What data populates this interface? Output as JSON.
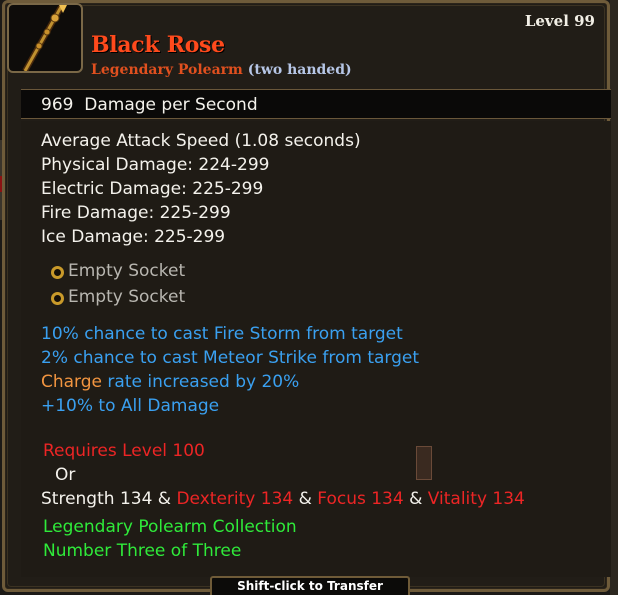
{
  "item": {
    "level_label": "Level 99",
    "name": "Black Rose",
    "type": "Legendary Polearm",
    "handedness": "(two handed)",
    "dps_value": "969",
    "dps_label": "Damage per Second",
    "icon": "polearm-icon"
  },
  "stats": {
    "attack_speed": "Average Attack Speed (1.08 seconds)",
    "physical": "Physical Damage: 224-299",
    "electric": "Electric Damage: 225-299",
    "fire": "Fire Damage: 225-299",
    "ice": "Ice Damage: 225-299"
  },
  "sockets": [
    {
      "label": "Empty Socket"
    },
    {
      "label": "Empty Socket"
    }
  ],
  "enchants": {
    "fire_storm": "10% chance to cast Fire Storm from target",
    "meteor": "2% chance to cast Meteor Strike from target",
    "charge_word": "Charge",
    "charge_rest": " rate increased by 20%",
    "all_damage": "+10% to All Damage"
  },
  "requirements": {
    "level": "Requires Level 100",
    "or": "Or",
    "strength": "Strength 134",
    "amp1": " & ",
    "dexterity": "Dexterity 134",
    "amp2": " & ",
    "focus": "Focus 134",
    "amp3": " & ",
    "vitality": "Vitality 134"
  },
  "set": {
    "collection": "Legendary Polearm Collection",
    "piece": "Number Three of Three"
  },
  "footer": {
    "transfer_hint": "Shift-click to Transfer"
  },
  "colors": {
    "name": "#ff4a1c",
    "type": "#e0501f",
    "handedness": "#b6c6e6",
    "enchant_blue": "#3aa0f0",
    "charge_orange": "#f29540",
    "requirement_red": "#ec2525",
    "set_green": "#2fea3a",
    "socket_gold": "#c99a2a"
  }
}
